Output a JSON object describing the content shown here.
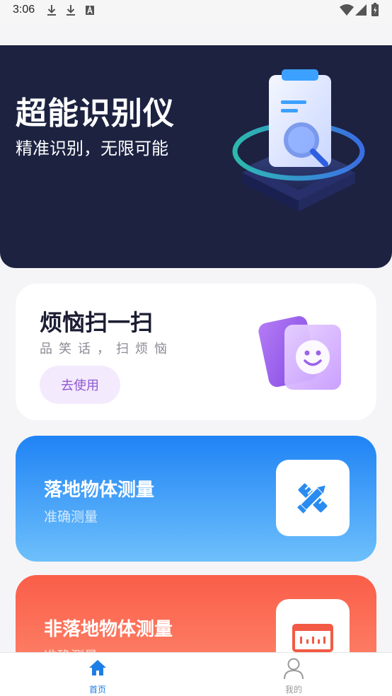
{
  "status_bar": {
    "time": "3:06",
    "left_icons": [
      "download-icon",
      "download-icon",
      "font-a-icon"
    ],
    "right_icons": [
      "wifi-icon",
      "cellular-icon",
      "battery-icon"
    ]
  },
  "hero": {
    "title": "超能识别仪",
    "subtitle": "精准识别，无限可能",
    "background_color": "#1c2240",
    "illustration": "magnifier-document-icon"
  },
  "worry_card": {
    "title": "烦恼扫一扫",
    "subtitle": "品笑话，扫烦恼",
    "button_label": "去使用",
    "illustration": "smile-face-icon",
    "accent_color": "#9058d2"
  },
  "measure_cards": [
    {
      "title": "落地物体测量",
      "subtitle": "准确测量",
      "icon": "pencil-ruler-icon",
      "color": "#1f83f5"
    },
    {
      "title": "非落地物体测量",
      "subtitle": "准确测量",
      "icon": "measuring-scale-icon",
      "color": "#fa5e49"
    }
  ],
  "tabbar": {
    "tabs": [
      {
        "label": "首页",
        "icon": "home-icon",
        "active": true
      },
      {
        "label": "我的",
        "icon": "user-icon",
        "active": false
      }
    ],
    "active_color": "#1c7ee6"
  }
}
